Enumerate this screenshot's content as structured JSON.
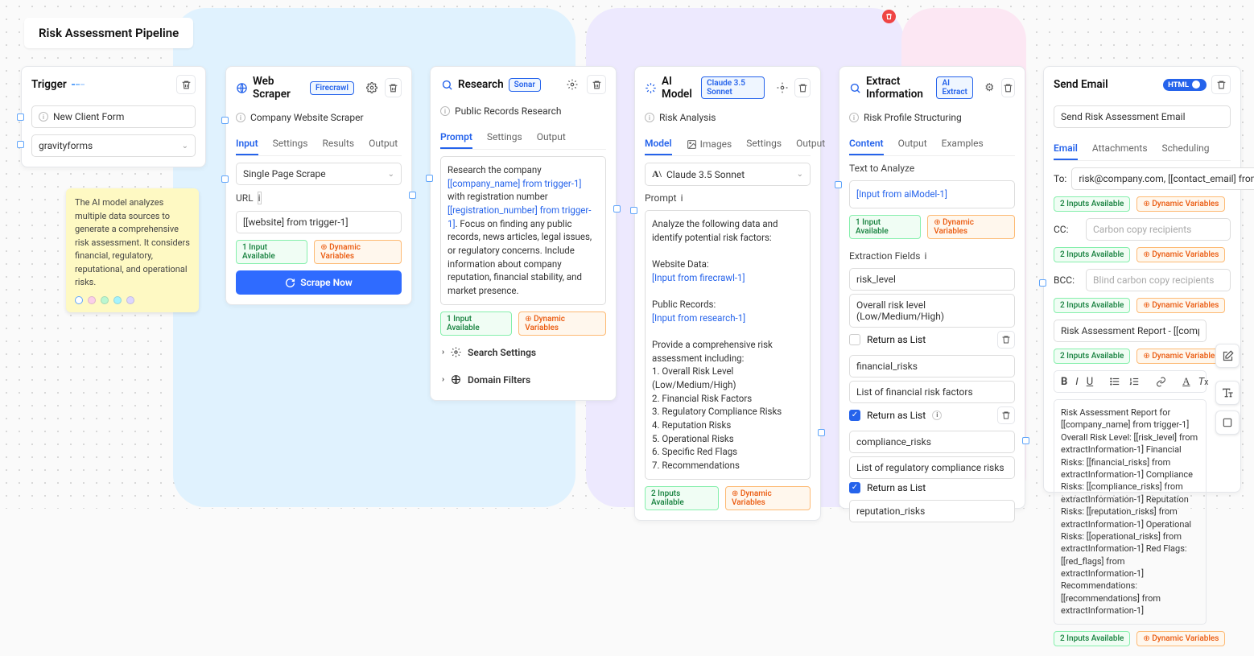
{
  "pipelineTitle": "Risk Assessment Pipeline",
  "note": {
    "text": "The AI model analyzes multiple data sources to generate a comprehensive risk assessment. It considers financial, regulatory, reputational, and operational risks."
  },
  "trigger": {
    "title": "Trigger",
    "formName": "New Client Form",
    "connector": "gravityforms"
  },
  "scraper": {
    "title": "Web Scraper",
    "badge": "Firecrawl",
    "subtitle": "Company Website Scraper",
    "tabs": {
      "input": "Input",
      "settings": "Settings",
      "results": "Results",
      "output": "Output"
    },
    "type": "Single Page Scrape",
    "urlLabel": "URL",
    "urlValue": "[[website] from trigger-1]",
    "chip1": "1 Input Available",
    "chip2": "Dynamic Variables",
    "button": "Scrape Now"
  },
  "research": {
    "title": "Research",
    "badge": "Sonar",
    "subtitle": "Public Records Research",
    "tabs": {
      "prompt": "Prompt",
      "settings": "Settings",
      "output": "Output"
    },
    "promptPre": "Research the company ",
    "var1": "[[company_name] from trigger-1]",
    "promptMid": " with registration number ",
    "var2": "[[registration_number] from trigger-1]",
    "promptPost": ". Focus on finding any public records, news articles, legal issues, or regulatory concerns. Include information about company reputation, financial stability, and market presence.",
    "chip1": "1 Input Available",
    "chip2": "Dynamic Variables",
    "sec1": "Search Settings",
    "sec2": "Domain Filters"
  },
  "aiModel": {
    "title": "AI Model",
    "badge": "Claude 3.5 Sonnet",
    "subtitle": "Risk Analysis",
    "tabs": {
      "model": "Model",
      "images": "Images",
      "settings": "Settings",
      "output": "Output"
    },
    "modelSelect": "Claude 3.5 Sonnet",
    "promptLabel": "Prompt",
    "pLine1": "Analyze the following data and identify potential risk factors:",
    "pLab1": "Website Data:",
    "pVar1": "[Input from firecrawl-1]",
    "pLab2": "Public Records:",
    "pVar2": "[Input from research-1]",
    "pListHead": "Provide a comprehensive risk assessment including:",
    "pItems": [
      "1. Overall Risk Level (Low/Medium/High)",
      "2. Financial Risk Factors",
      "3. Regulatory Compliance Risks",
      "4. Reputation Risks",
      "5. Operational Risks",
      "6. Specific Red Flags",
      "7. Recommendations"
    ],
    "chip1": "2 Inputs Available",
    "chip2": "Dynamic Variables"
  },
  "extract": {
    "title": "Extract Information",
    "badge": "AI Extract",
    "subtitle": "Risk Profile Structuring",
    "tabs": {
      "content": "Content",
      "output": "Output",
      "examples": "Examples"
    },
    "analyzeLabel": "Text to Analyze",
    "analyzeVal": "[Input from aiModel-1]",
    "chip1": "1 Input Available",
    "chip2": "Dynamic Variables",
    "fieldsLabel": "Extraction Fields",
    "returnAsList": "Return as List",
    "fields": [
      {
        "name": "risk_level",
        "desc": "Overall risk level (Low/Medium/High)",
        "checked": false
      },
      {
        "name": "financial_risks",
        "desc": "List of financial risk factors",
        "checked": true
      },
      {
        "name": "compliance_risks",
        "desc": "List of regulatory compliance risks",
        "checked": true
      },
      {
        "name": "reputation_risks",
        "desc": "",
        "checked": null
      }
    ]
  },
  "email": {
    "title": "Send Email",
    "toggle": "HTML",
    "subtitle": "Send Risk Assessment Email",
    "tabs": {
      "email": "Email",
      "attachments": "Attachments",
      "scheduling": "Scheduling"
    },
    "toLabel": "To:",
    "toVal": "risk@company.com, [[contact_email] from trigg",
    "ccLabel": "CC:",
    "ccPH": "Carbon copy recipients",
    "bccLabel": "BCC:",
    "bccPH": "Blind carbon copy recipients",
    "subject": "Risk Assessment Report - [[company_name] f",
    "chip1": "2 Inputs Available",
    "chip2": "Dynamic Variables",
    "body": "Risk Assessment Report for [[company_name] from trigger-1] Overall Risk Level: [[risk_level] from extractInformation-1] Financial Risks: [[financial_risks] from extractInformation-1] Compliance Risks: [[compliance_risks] from extractInformation-1] Reputation Risks: [[reputation_risks] from extractInformation-1] Operational Risks: [[operational_risks] from extractInformation-1] Red Flags: [[red_flags] from extractInformation-1] Recommendations: [[recommendations] from extractInformation-1]"
  }
}
